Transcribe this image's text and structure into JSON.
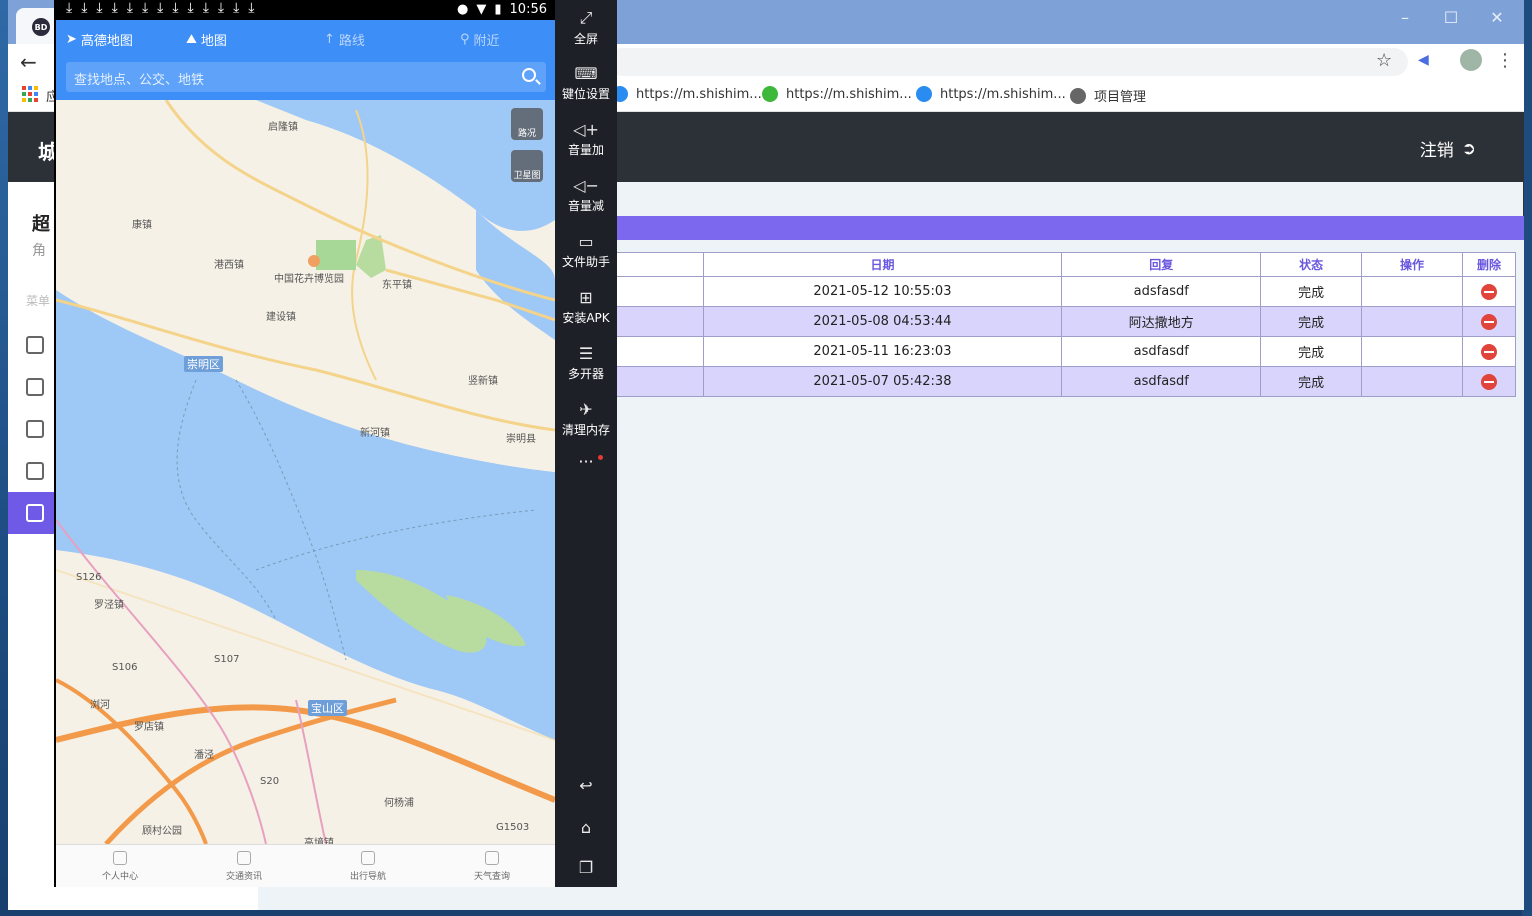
{
  "browser": {
    "tab_favicon": "BD",
    "back_icon": "←",
    "bookmarks_apps_label": "应",
    "bookmarks": [
      {
        "label": "https://m.shishim...",
        "icon": "globe-blue-icon",
        "color": "#2a8cf0"
      },
      {
        "label": "https://m.shishim...",
        "icon": "wechat-icon",
        "color": "#3db83a"
      },
      {
        "label": "https://m.shishim...",
        "icon": "edge-icon",
        "color": "#2a8cf0"
      },
      {
        "label": "项目管理",
        "icon": "globe-icon",
        "color": "#666666"
      }
    ]
  },
  "page": {
    "logo": "城",
    "logout": "注销",
    "sidebar_title": "超",
    "sidebar_sub": "角",
    "sidebar_small": "菜单",
    "accent": "#7b68ee",
    "table": {
      "headers": [
        "日期",
        "回复",
        "状态",
        "操作",
        "删除"
      ],
      "rows": [
        {
          "date": "2021-05-12 10:55:03",
          "reply": "adsfasdf",
          "status": "完成"
        },
        {
          "date": "2021-05-08 04:53:44",
          "reply": "阿达撒地方",
          "status": "完成"
        },
        {
          "date": "2021-05-11 16:23:03",
          "reply": "asdfasdf",
          "status": "完成"
        },
        {
          "date": "2021-05-07 05:42:38",
          "reply": "asdfasdf",
          "status": "完成"
        }
      ]
    }
  },
  "emulator": {
    "status_time": "10:56",
    "app_name": "高德地图",
    "tabs": [
      "地图",
      "路线",
      "附近"
    ],
    "search_placeholder": "查找地点、公交、地铁",
    "map_buttons": [
      "路况",
      "卫星图"
    ],
    "map_labels": {
      "l1": "启隆镇",
      "l2": "康镇",
      "l3": "港西镇",
      "l4": "中国花卉博览园",
      "l5": "东平镇",
      "l6": "建设镇",
      "l7": "崇明区",
      "l8": "竖新镇",
      "l9": "新河镇",
      "l10": "崇明县",
      "l11": "罗泾镇",
      "l12": "罗店镇",
      "l13": "宝山区",
      "l14": "顾村公园",
      "l15": "高境镇",
      "l16": "S126",
      "l17": "S106",
      "l18": "S107",
      "l19": "S20",
      "l20": "G1503",
      "l21": "浏河",
      "l22": "潘泾",
      "l23": "何杨浦"
    },
    "bottom_nav": [
      "个人中心",
      "交通资讯",
      "出行导航",
      "天气查询"
    ],
    "side_buttons": [
      "全屏",
      "键位设置",
      "音量加",
      "音量减",
      "文件助手",
      "安装APK",
      "多开器",
      "清理内存"
    ],
    "more": "···"
  }
}
